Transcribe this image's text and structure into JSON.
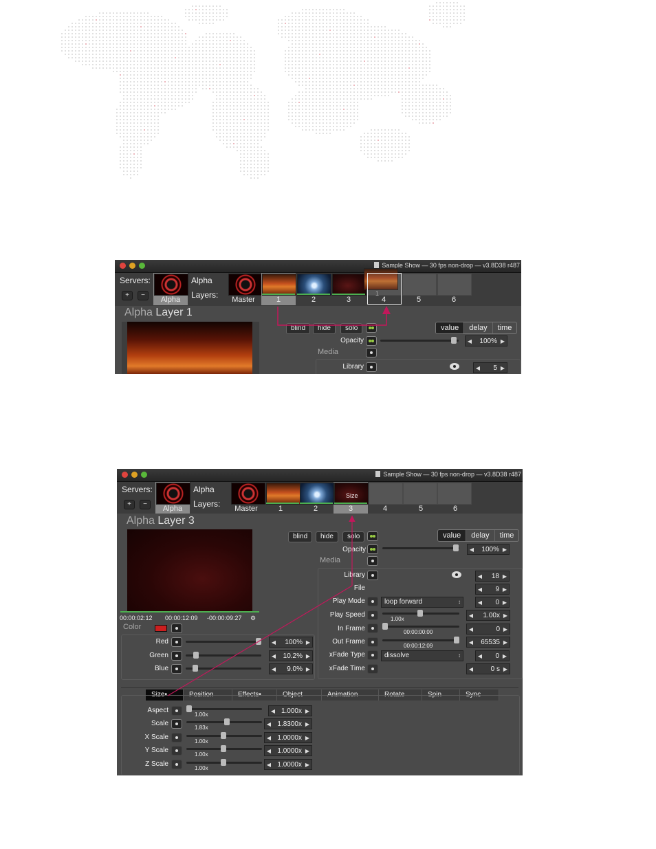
{
  "shot1": {
    "window_title": "Sample Show  —  30 fps non-drop  —  v3.8D38 r487",
    "servers_label": "Servers:",
    "server_name": "Alpha",
    "server_thumb_label": "Alpha",
    "layers_label": "Layers:",
    "master_label": "Master",
    "layers": [
      "1",
      "2",
      "3",
      "4",
      "5",
      "6"
    ],
    "drag_ghost_label": "1",
    "heading_server": "Alpha",
    "heading_layer": "Layer 1",
    "buttons": {
      "blind": "blind",
      "hide": "hide",
      "solo": "solo"
    },
    "modes": [
      "value",
      "delay",
      "time"
    ],
    "opacity_label": "Opacity",
    "opacity_value": "100%",
    "media_label": "Media",
    "library_label": "Library",
    "library_value": "5"
  },
  "shot2": {
    "window_title": "Sample Show  —  30 fps non-drop  —  v3.8D38 r487",
    "servers_label": "Servers:",
    "server_name": "Alpha",
    "server_thumb_label": "Alpha",
    "layers_label": "Layers:",
    "master_label": "Master",
    "layers": [
      "1",
      "2",
      "3",
      "4",
      "5",
      "6"
    ],
    "thumb_overlay": "Size",
    "heading_server": "Alpha",
    "heading_layer": "Layer 3",
    "buttons": {
      "blind": "blind",
      "hide": "hide",
      "solo": "solo"
    },
    "modes": [
      "value",
      "delay",
      "time"
    ],
    "opacity_label": "Opacity",
    "opacity_value": "100%",
    "media_label": "Media",
    "timecodes": [
      "00:00:02:12",
      "00:00:12:09",
      "-00:00:09:27"
    ],
    "color_label": "Color",
    "color_swatch": "#cc1f1f",
    "rgb": [
      {
        "label": "Red",
        "value": "100%"
      },
      {
        "label": "Green",
        "value": "10.2%"
      },
      {
        "label": "Blue",
        "value": "9.0%"
      }
    ],
    "media_rows": {
      "library": {
        "label": "Library",
        "value": "18"
      },
      "file": {
        "label": "File",
        "value": "9"
      },
      "play_mode": {
        "label": "Play Mode",
        "option": "loop forward",
        "value": "0"
      },
      "play_speed": {
        "label": "Play Speed",
        "value": "1.00x",
        "slider": "1.00x"
      },
      "in_frame": {
        "label": "In Frame",
        "value": "0",
        "slider": "00:00:00:00"
      },
      "out_frame": {
        "label": "Out Frame",
        "value": "65535",
        "slider": "00:00:12:09"
      },
      "xfade_type": {
        "label": "xFade Type",
        "option": "dissolve",
        "value": "0"
      },
      "xfade_time": {
        "label": "xFade Time",
        "value": "0 s"
      }
    },
    "tabs": [
      "Size•",
      "Position",
      "Effects•",
      "Object",
      "Animation",
      "Rotate",
      "Spin",
      "Sync"
    ],
    "size_rows": [
      {
        "label": "Aspect",
        "slider": "1.00x",
        "value": "1.000x"
      },
      {
        "label": "Scale",
        "slider": "1.83x",
        "value": "1.8300x"
      },
      {
        "label": "X Scale",
        "slider": "1.00x",
        "value": "1.0000x"
      },
      {
        "label": "Y Scale",
        "slider": "1.00x",
        "value": "1.0000x"
      },
      {
        "label": "Z Scale",
        "slider": "1.00x",
        "value": "1.0000x"
      }
    ]
  },
  "colors": {
    "accent_arrow": "#c2185b",
    "window_bg": "#4a4a4a"
  }
}
